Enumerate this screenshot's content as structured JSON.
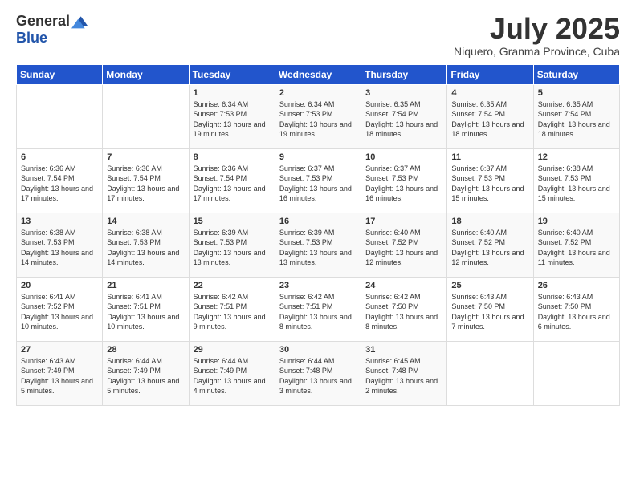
{
  "logo": {
    "general": "General",
    "blue": "Blue"
  },
  "header": {
    "month": "July 2025",
    "location": "Niquero, Granma Province, Cuba"
  },
  "weekdays": [
    "Sunday",
    "Monday",
    "Tuesday",
    "Wednesday",
    "Thursday",
    "Friday",
    "Saturday"
  ],
  "weeks": [
    [
      {
        "day": "",
        "sunrise": "",
        "sunset": "",
        "daylight": ""
      },
      {
        "day": "",
        "sunrise": "",
        "sunset": "",
        "daylight": ""
      },
      {
        "day": "1",
        "sunrise": "Sunrise: 6:34 AM",
        "sunset": "Sunset: 7:53 PM",
        "daylight": "Daylight: 13 hours and 19 minutes."
      },
      {
        "day": "2",
        "sunrise": "Sunrise: 6:34 AM",
        "sunset": "Sunset: 7:53 PM",
        "daylight": "Daylight: 13 hours and 19 minutes."
      },
      {
        "day": "3",
        "sunrise": "Sunrise: 6:35 AM",
        "sunset": "Sunset: 7:54 PM",
        "daylight": "Daylight: 13 hours and 18 minutes."
      },
      {
        "day": "4",
        "sunrise": "Sunrise: 6:35 AM",
        "sunset": "Sunset: 7:54 PM",
        "daylight": "Daylight: 13 hours and 18 minutes."
      },
      {
        "day": "5",
        "sunrise": "Sunrise: 6:35 AM",
        "sunset": "Sunset: 7:54 PM",
        "daylight": "Daylight: 13 hours and 18 minutes."
      }
    ],
    [
      {
        "day": "6",
        "sunrise": "Sunrise: 6:36 AM",
        "sunset": "Sunset: 7:54 PM",
        "daylight": "Daylight: 13 hours and 17 minutes."
      },
      {
        "day": "7",
        "sunrise": "Sunrise: 6:36 AM",
        "sunset": "Sunset: 7:54 PM",
        "daylight": "Daylight: 13 hours and 17 minutes."
      },
      {
        "day": "8",
        "sunrise": "Sunrise: 6:36 AM",
        "sunset": "Sunset: 7:54 PM",
        "daylight": "Daylight: 13 hours and 17 minutes."
      },
      {
        "day": "9",
        "sunrise": "Sunrise: 6:37 AM",
        "sunset": "Sunset: 7:53 PM",
        "daylight": "Daylight: 13 hours and 16 minutes."
      },
      {
        "day": "10",
        "sunrise": "Sunrise: 6:37 AM",
        "sunset": "Sunset: 7:53 PM",
        "daylight": "Daylight: 13 hours and 16 minutes."
      },
      {
        "day": "11",
        "sunrise": "Sunrise: 6:37 AM",
        "sunset": "Sunset: 7:53 PM",
        "daylight": "Daylight: 13 hours and 15 minutes."
      },
      {
        "day": "12",
        "sunrise": "Sunrise: 6:38 AM",
        "sunset": "Sunset: 7:53 PM",
        "daylight": "Daylight: 13 hours and 15 minutes."
      }
    ],
    [
      {
        "day": "13",
        "sunrise": "Sunrise: 6:38 AM",
        "sunset": "Sunset: 7:53 PM",
        "daylight": "Daylight: 13 hours and 14 minutes."
      },
      {
        "day": "14",
        "sunrise": "Sunrise: 6:38 AM",
        "sunset": "Sunset: 7:53 PM",
        "daylight": "Daylight: 13 hours and 14 minutes."
      },
      {
        "day": "15",
        "sunrise": "Sunrise: 6:39 AM",
        "sunset": "Sunset: 7:53 PM",
        "daylight": "Daylight: 13 hours and 13 minutes."
      },
      {
        "day": "16",
        "sunrise": "Sunrise: 6:39 AM",
        "sunset": "Sunset: 7:53 PM",
        "daylight": "Daylight: 13 hours and 13 minutes."
      },
      {
        "day": "17",
        "sunrise": "Sunrise: 6:40 AM",
        "sunset": "Sunset: 7:52 PM",
        "daylight": "Daylight: 13 hours and 12 minutes."
      },
      {
        "day": "18",
        "sunrise": "Sunrise: 6:40 AM",
        "sunset": "Sunset: 7:52 PM",
        "daylight": "Daylight: 13 hours and 12 minutes."
      },
      {
        "day": "19",
        "sunrise": "Sunrise: 6:40 AM",
        "sunset": "Sunset: 7:52 PM",
        "daylight": "Daylight: 13 hours and 11 minutes."
      }
    ],
    [
      {
        "day": "20",
        "sunrise": "Sunrise: 6:41 AM",
        "sunset": "Sunset: 7:52 PM",
        "daylight": "Daylight: 13 hours and 10 minutes."
      },
      {
        "day": "21",
        "sunrise": "Sunrise: 6:41 AM",
        "sunset": "Sunset: 7:51 PM",
        "daylight": "Daylight: 13 hours and 10 minutes."
      },
      {
        "day": "22",
        "sunrise": "Sunrise: 6:42 AM",
        "sunset": "Sunset: 7:51 PM",
        "daylight": "Daylight: 13 hours and 9 minutes."
      },
      {
        "day": "23",
        "sunrise": "Sunrise: 6:42 AM",
        "sunset": "Sunset: 7:51 PM",
        "daylight": "Daylight: 13 hours and 8 minutes."
      },
      {
        "day": "24",
        "sunrise": "Sunrise: 6:42 AM",
        "sunset": "Sunset: 7:50 PM",
        "daylight": "Daylight: 13 hours and 8 minutes."
      },
      {
        "day": "25",
        "sunrise": "Sunrise: 6:43 AM",
        "sunset": "Sunset: 7:50 PM",
        "daylight": "Daylight: 13 hours and 7 minutes."
      },
      {
        "day": "26",
        "sunrise": "Sunrise: 6:43 AM",
        "sunset": "Sunset: 7:50 PM",
        "daylight": "Daylight: 13 hours and 6 minutes."
      }
    ],
    [
      {
        "day": "27",
        "sunrise": "Sunrise: 6:43 AM",
        "sunset": "Sunset: 7:49 PM",
        "daylight": "Daylight: 13 hours and 5 minutes."
      },
      {
        "day": "28",
        "sunrise": "Sunrise: 6:44 AM",
        "sunset": "Sunset: 7:49 PM",
        "daylight": "Daylight: 13 hours and 5 minutes."
      },
      {
        "day": "29",
        "sunrise": "Sunrise: 6:44 AM",
        "sunset": "Sunset: 7:49 PM",
        "daylight": "Daylight: 13 hours and 4 minutes."
      },
      {
        "day": "30",
        "sunrise": "Sunrise: 6:44 AM",
        "sunset": "Sunset: 7:48 PM",
        "daylight": "Daylight: 13 hours and 3 minutes."
      },
      {
        "day": "31",
        "sunrise": "Sunrise: 6:45 AM",
        "sunset": "Sunset: 7:48 PM",
        "daylight": "Daylight: 13 hours and 2 minutes."
      },
      {
        "day": "",
        "sunrise": "",
        "sunset": "",
        "daylight": ""
      },
      {
        "day": "",
        "sunrise": "",
        "sunset": "",
        "daylight": ""
      }
    ]
  ]
}
